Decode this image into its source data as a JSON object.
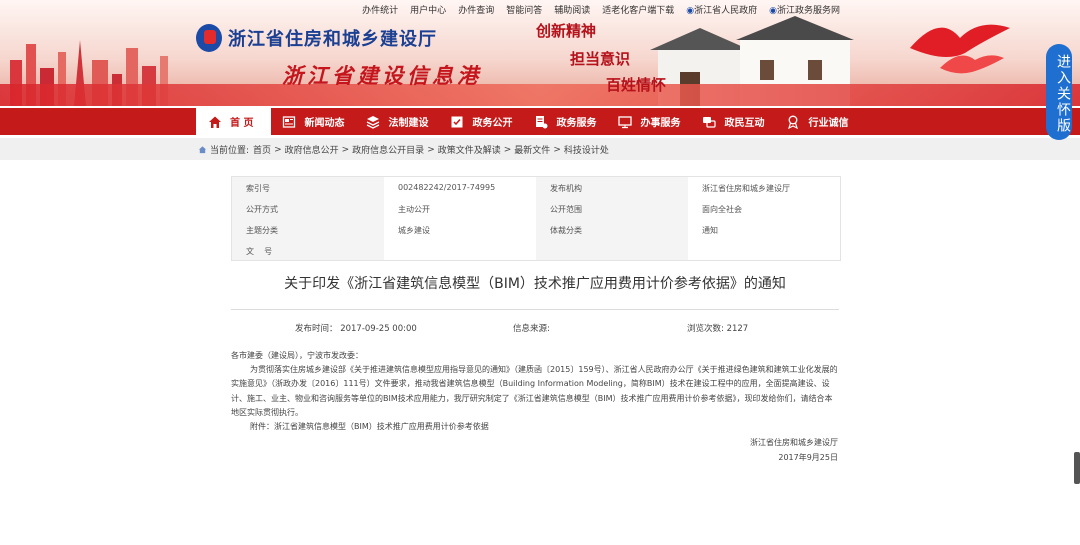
{
  "top_links": [
    "办件统计",
    "用户中心",
    "办件查询",
    "智能问答",
    "辅助阅读",
    "适老化客户端下载",
    "浙江省人民政府",
    "浙江政务服务网"
  ],
  "org_name": "浙江省住房和城乡建设厅",
  "site_slogan": "浙江省建设信息港",
  "slogans": [
    "创新精神",
    "担当意识",
    "百姓情怀"
  ],
  "care_button": "进入关怀版",
  "nav": [
    {
      "label": "首 页",
      "icon": "home-icon"
    },
    {
      "label": "新闻动态",
      "icon": "news-icon"
    },
    {
      "label": "法制建设",
      "icon": "layers-icon"
    },
    {
      "label": "政务公开",
      "icon": "checklist-icon"
    },
    {
      "label": "政务服务",
      "icon": "document-icon"
    },
    {
      "label": "办事服务",
      "icon": "monitor-icon"
    },
    {
      "label": "政民互动",
      "icon": "chat-icon"
    },
    {
      "label": "行业诚信",
      "icon": "medal-icon"
    }
  ],
  "breadcrumb": {
    "prefix": "当前位置:",
    "items": [
      "首页",
      "政府信息公开",
      "政府信息公开目录",
      "政策文件及解读",
      "最新文件",
      "科技设计处"
    ],
    "separator": ">"
  },
  "meta": {
    "index_label": "索引号",
    "index_value": "002482242/2017-74995",
    "publisher_label": "发布机构",
    "publisher_value": "浙江省住房和城乡建设厅",
    "method_label": "公开方式",
    "method_value": "主动公开",
    "scope_label": "公开范围",
    "scope_value": "面向全社会",
    "topic_label": "主题分类",
    "topic_value": "城乡建设",
    "genre_label": "体裁分类",
    "genre_value": "通知",
    "docno_label": "文    号"
  },
  "title": "关于印发《浙江省建筑信息模型（BIM）技术推广应用费用计价参考依据》的通知",
  "info": {
    "publish_time": "发布时间：  2017-09-25 00:00",
    "source": "信息来源:",
    "views": "浏览次数: 2127"
  },
  "body": {
    "salutation": "各市建委（建设局），宁波市发改委：",
    "para1": "为贯彻落实住房城乡建设部《关于推进建筑信息模型应用指导意见的通知》（建质函〔2015〕159号）、浙江省人民政府办公厅《关于推进绿色建筑和建筑工业化发展的实施意见》（浙政办发〔2016〕111号）文件要求，推动我省建筑信息模型（Building Information Modeling，简称BIM）技术在建设工程中的应用，全面提高建设、设计、施工、业主、物业和咨询服务等单位的BIM技术应用能力，我厅研究制定了《浙江省建筑信息模型（BIM）技术推广应用费用计价参考依据》，现印发给你们，请结合本地区实际贯彻执行。",
    "attachment": "附件：浙江省建筑信息模型（BIM）技术推广应用费用计价参考依据",
    "signature": "浙江省住房和城乡建设厅",
    "date": "2017年9月25日"
  }
}
